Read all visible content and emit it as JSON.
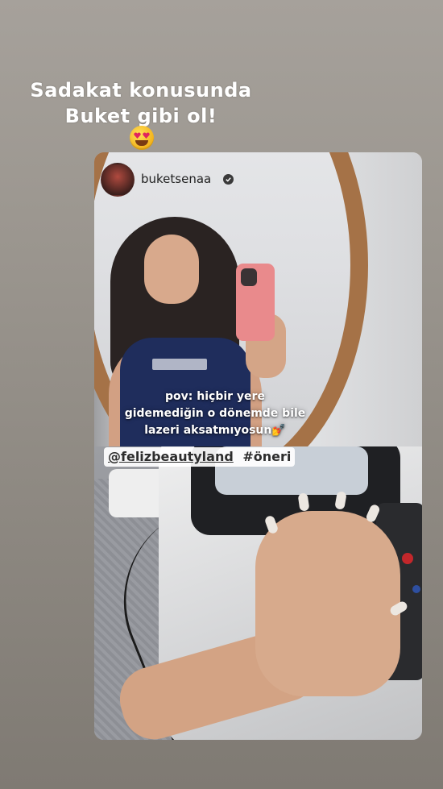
{
  "story": {
    "headline_line1": "Sadakat konusunda",
    "headline_line2": "Buket gibi ol!",
    "emoji": "heart-eyes-emoji"
  },
  "post": {
    "username": "buketsenaa",
    "verified": true,
    "caption_line1": "pov: hiçbir yere",
    "caption_line2": "gidemediğin o dönemde bile",
    "caption_line3": "lazeri aksatmıyosun💅",
    "mention": "@felizbeautyland",
    "hashtag": "#öneri"
  },
  "colors": {
    "background_top": "#a6a19b",
    "background_bottom": "#7f7a73",
    "mirror_frame": "#a57247",
    "top_shirt": "#1f2d5c",
    "phone_case": "#e98a8c",
    "machine_button_red": "#c3272b"
  }
}
